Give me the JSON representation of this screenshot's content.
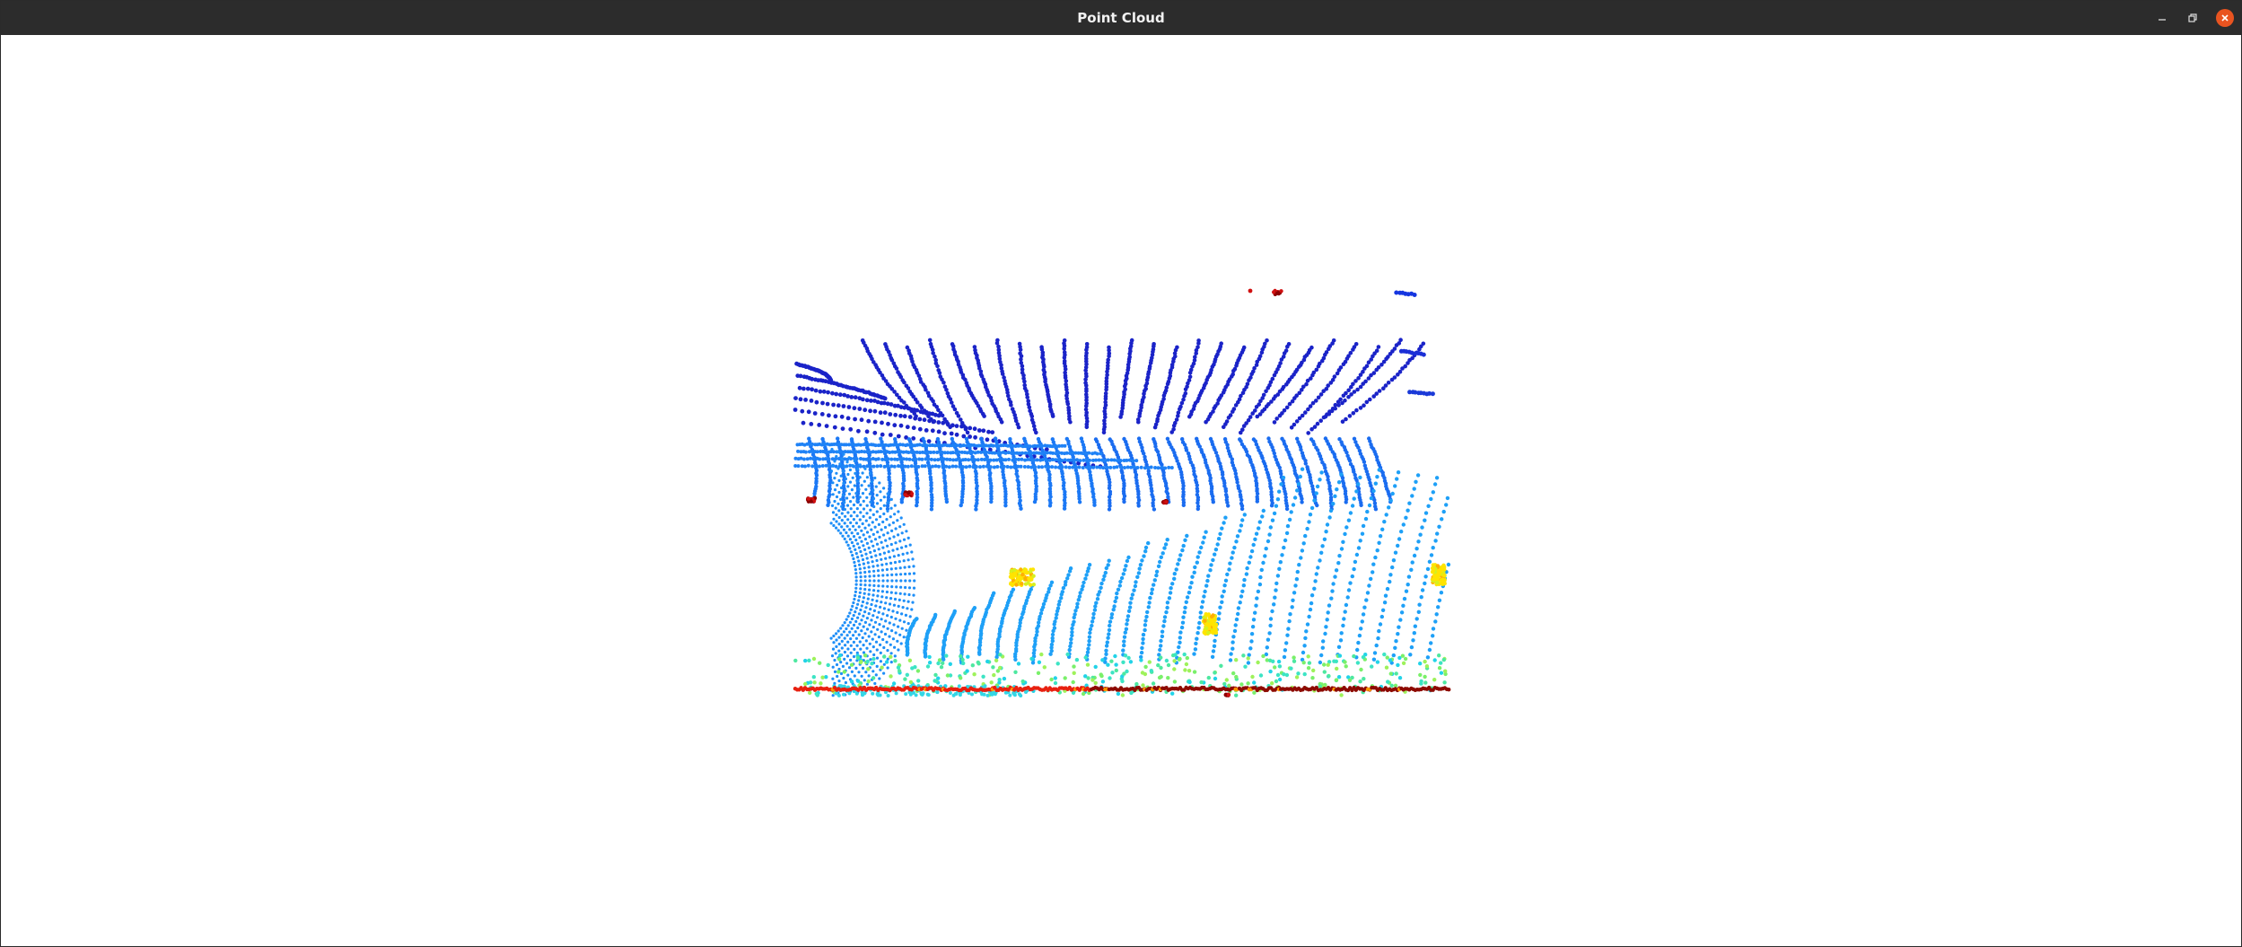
{
  "window": {
    "title": "Point Cloud"
  },
  "controls": {
    "minimize_icon": "minimize-icon",
    "maximize_icon": "restore-icon",
    "close_icon": "close-icon"
  },
  "colors": {
    "titlebar": "#2c2c2c",
    "close": "#e95420",
    "background": "#ffffff",
    "colormap": "jet"
  }
}
